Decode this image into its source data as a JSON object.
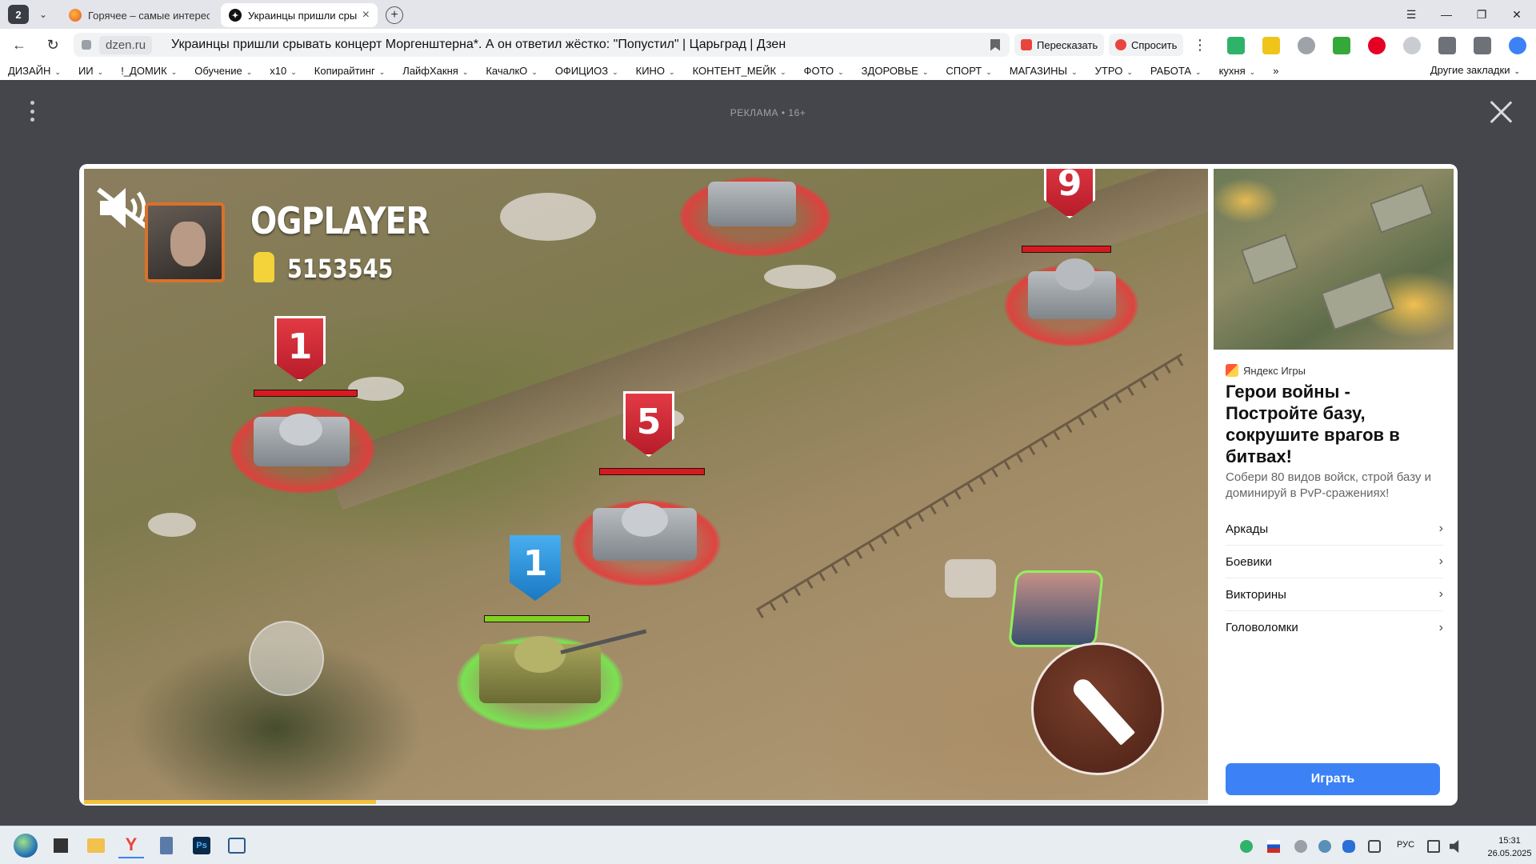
{
  "browser": {
    "tab_count": "2",
    "tabs": [
      {
        "title": "Горячее – самые интерес",
        "active": false
      },
      {
        "title": "Украинцы пришли сры",
        "active": true
      }
    ],
    "new_tab_symbol": "+",
    "window_controls": {
      "menu": "☰",
      "minimize": "—",
      "restore": "❐",
      "close": "✕"
    }
  },
  "address_bar": {
    "domain": "dzen.ru",
    "page_title": "Украинцы пришли срывать концерт Моргенштерна*. А он ответил жёстко: \"Попустил\" | Царьград | Дзен",
    "retell_label": "Пересказать",
    "ask_label": "Спросить",
    "more_symbol": "⋮"
  },
  "bookmarks": {
    "items": [
      "ДИЗАЙН",
      "ИИ",
      "!_ДОМИК",
      "Обучение",
      "x10",
      "Копирайтинг",
      "ЛайфХакня",
      "КачалкО",
      "ОФИЦИОЗ",
      "КИНО",
      "КОНТЕНТ_МЕЙК",
      "ФОТО",
      "ЗДОРОВЬЕ",
      "СПОРТ",
      "МАГАЗИНЫ",
      "УТРО",
      "РАБОТА",
      "кухня"
    ],
    "overflow": "»",
    "other": "Другие закладки"
  },
  "overlay": {
    "ad_label": "РЕКЛАМА • 16+"
  },
  "game": {
    "player_name": "OGPLAYER",
    "player_score": "5153545",
    "enemies": [
      {
        "level": "1",
        "side": "enemy"
      },
      {
        "level": "5",
        "side": "enemy"
      },
      {
        "level": "9",
        "side": "enemy"
      }
    ],
    "ally": {
      "level": "1",
      "side": "ally"
    },
    "video_progress": 0.26
  },
  "ad": {
    "brand": "Яндекс Игры",
    "headline": "Герои войны - Постройте базу, сокрушите врагов в битвах!",
    "description": "Собери 80 видов войск, строй базу и доминируй в PvP-сражениях!",
    "categories": [
      "Аркады",
      "Боевики",
      "Викторины",
      "Головоломки"
    ],
    "chevron": "›",
    "play_label": "Играть"
  },
  "taskbar": {
    "language": "РУС",
    "time": "15:31",
    "date": "26.05.2025"
  },
  "colors": {
    "accent_blue": "#3c82f6",
    "enemy_red": "#d41b22",
    "ally_green": "#7ed321",
    "progress_yellow": "#f3c23a"
  }
}
